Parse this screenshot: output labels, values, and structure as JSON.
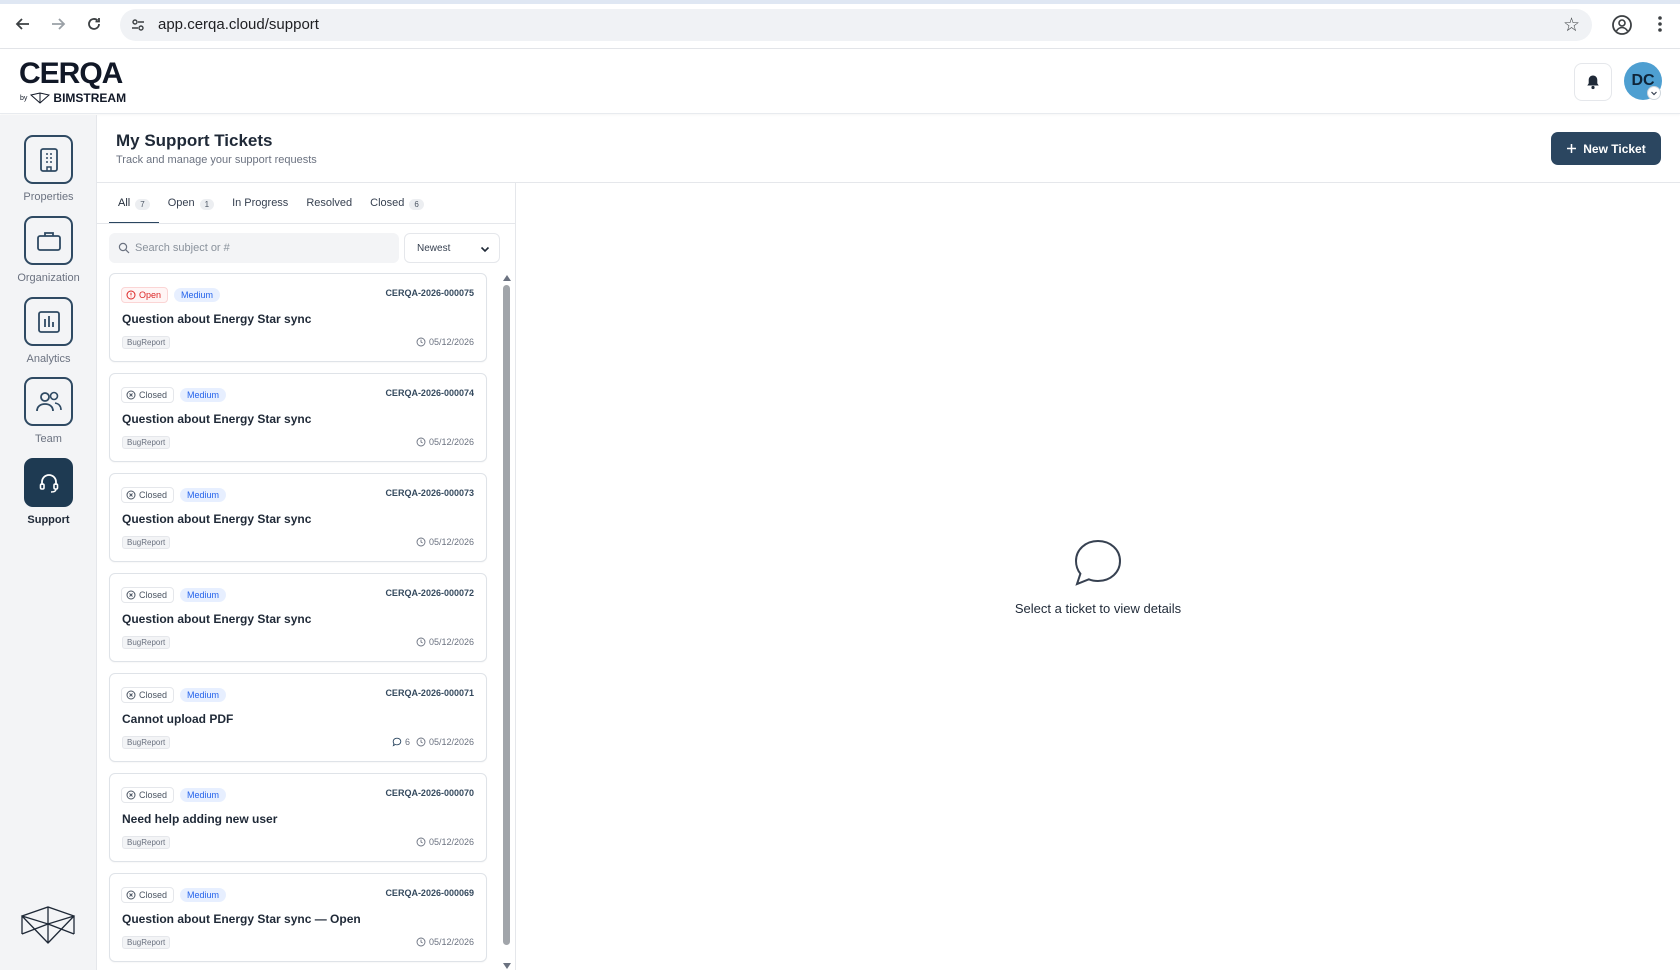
{
  "browser": {
    "url": "app.cerqa.cloud/support"
  },
  "app": {
    "logo": "CERQA",
    "logo_by": "by",
    "logo_brand": "BIMSTREAM",
    "avatar_initials": "DC"
  },
  "sidebar": {
    "items": [
      {
        "label": "Properties",
        "icon": "building-icon"
      },
      {
        "label": "Organization",
        "icon": "briefcase-icon"
      },
      {
        "label": "Analytics",
        "icon": "bar-chart-icon"
      },
      {
        "label": "Team",
        "icon": "users-icon"
      },
      {
        "label": "Support",
        "icon": "headset-icon",
        "active": true
      }
    ]
  },
  "page": {
    "title": "My Support Tickets",
    "subtitle": "Track and manage your support requests",
    "new_ticket_label": "New Ticket"
  },
  "tabs": [
    {
      "label": "All",
      "count": "7",
      "active": true
    },
    {
      "label": "Open",
      "count": "1"
    },
    {
      "label": "In Progress",
      "count": ""
    },
    {
      "label": "Resolved",
      "count": ""
    },
    {
      "label": "Closed",
      "count": "6"
    }
  ],
  "search": {
    "placeholder": "Search subject or #",
    "value": ""
  },
  "sort": {
    "selected": "Newest"
  },
  "tickets": [
    {
      "status": "Open",
      "priority": "Medium",
      "number": "CERQA-2026-000075",
      "title": "Question about Energy Star sync",
      "category": "BugReport",
      "comments": "",
      "date": "05/12/2026"
    },
    {
      "status": "Closed",
      "priority": "Medium",
      "number": "CERQA-2026-000074",
      "title": "Question about Energy Star sync",
      "category": "BugReport",
      "comments": "",
      "date": "05/12/2026"
    },
    {
      "status": "Closed",
      "priority": "Medium",
      "number": "CERQA-2026-000073",
      "title": "Question about Energy Star sync",
      "category": "BugReport",
      "comments": "",
      "date": "05/12/2026"
    },
    {
      "status": "Closed",
      "priority": "Medium",
      "number": "CERQA-2026-000072",
      "title": "Question about Energy Star sync",
      "category": "BugReport",
      "comments": "",
      "date": "05/12/2026"
    },
    {
      "status": "Closed",
      "priority": "Medium",
      "number": "CERQA-2026-000071",
      "title": "Cannot upload PDF",
      "category": "BugReport",
      "comments": "6",
      "date": "05/12/2026"
    },
    {
      "status": "Closed",
      "priority": "Medium",
      "number": "CERQA-2026-000070",
      "title": "Need help adding new user",
      "category": "BugReport",
      "comments": "",
      "date": "05/12/2026"
    },
    {
      "status": "Closed",
      "priority": "Medium",
      "number": "CERQA-2026-000069",
      "title": "Question about Energy Star sync — Open",
      "category": "BugReport",
      "comments": "",
      "date": "05/12/2026"
    }
  ],
  "detail": {
    "empty_text": "Select a ticket to view details"
  },
  "colors": {
    "brand_navy": "#2b4660",
    "open_red": "#dc2626",
    "priority_blue": "#2563eb",
    "avatar_blue": "#4e9fd1"
  }
}
